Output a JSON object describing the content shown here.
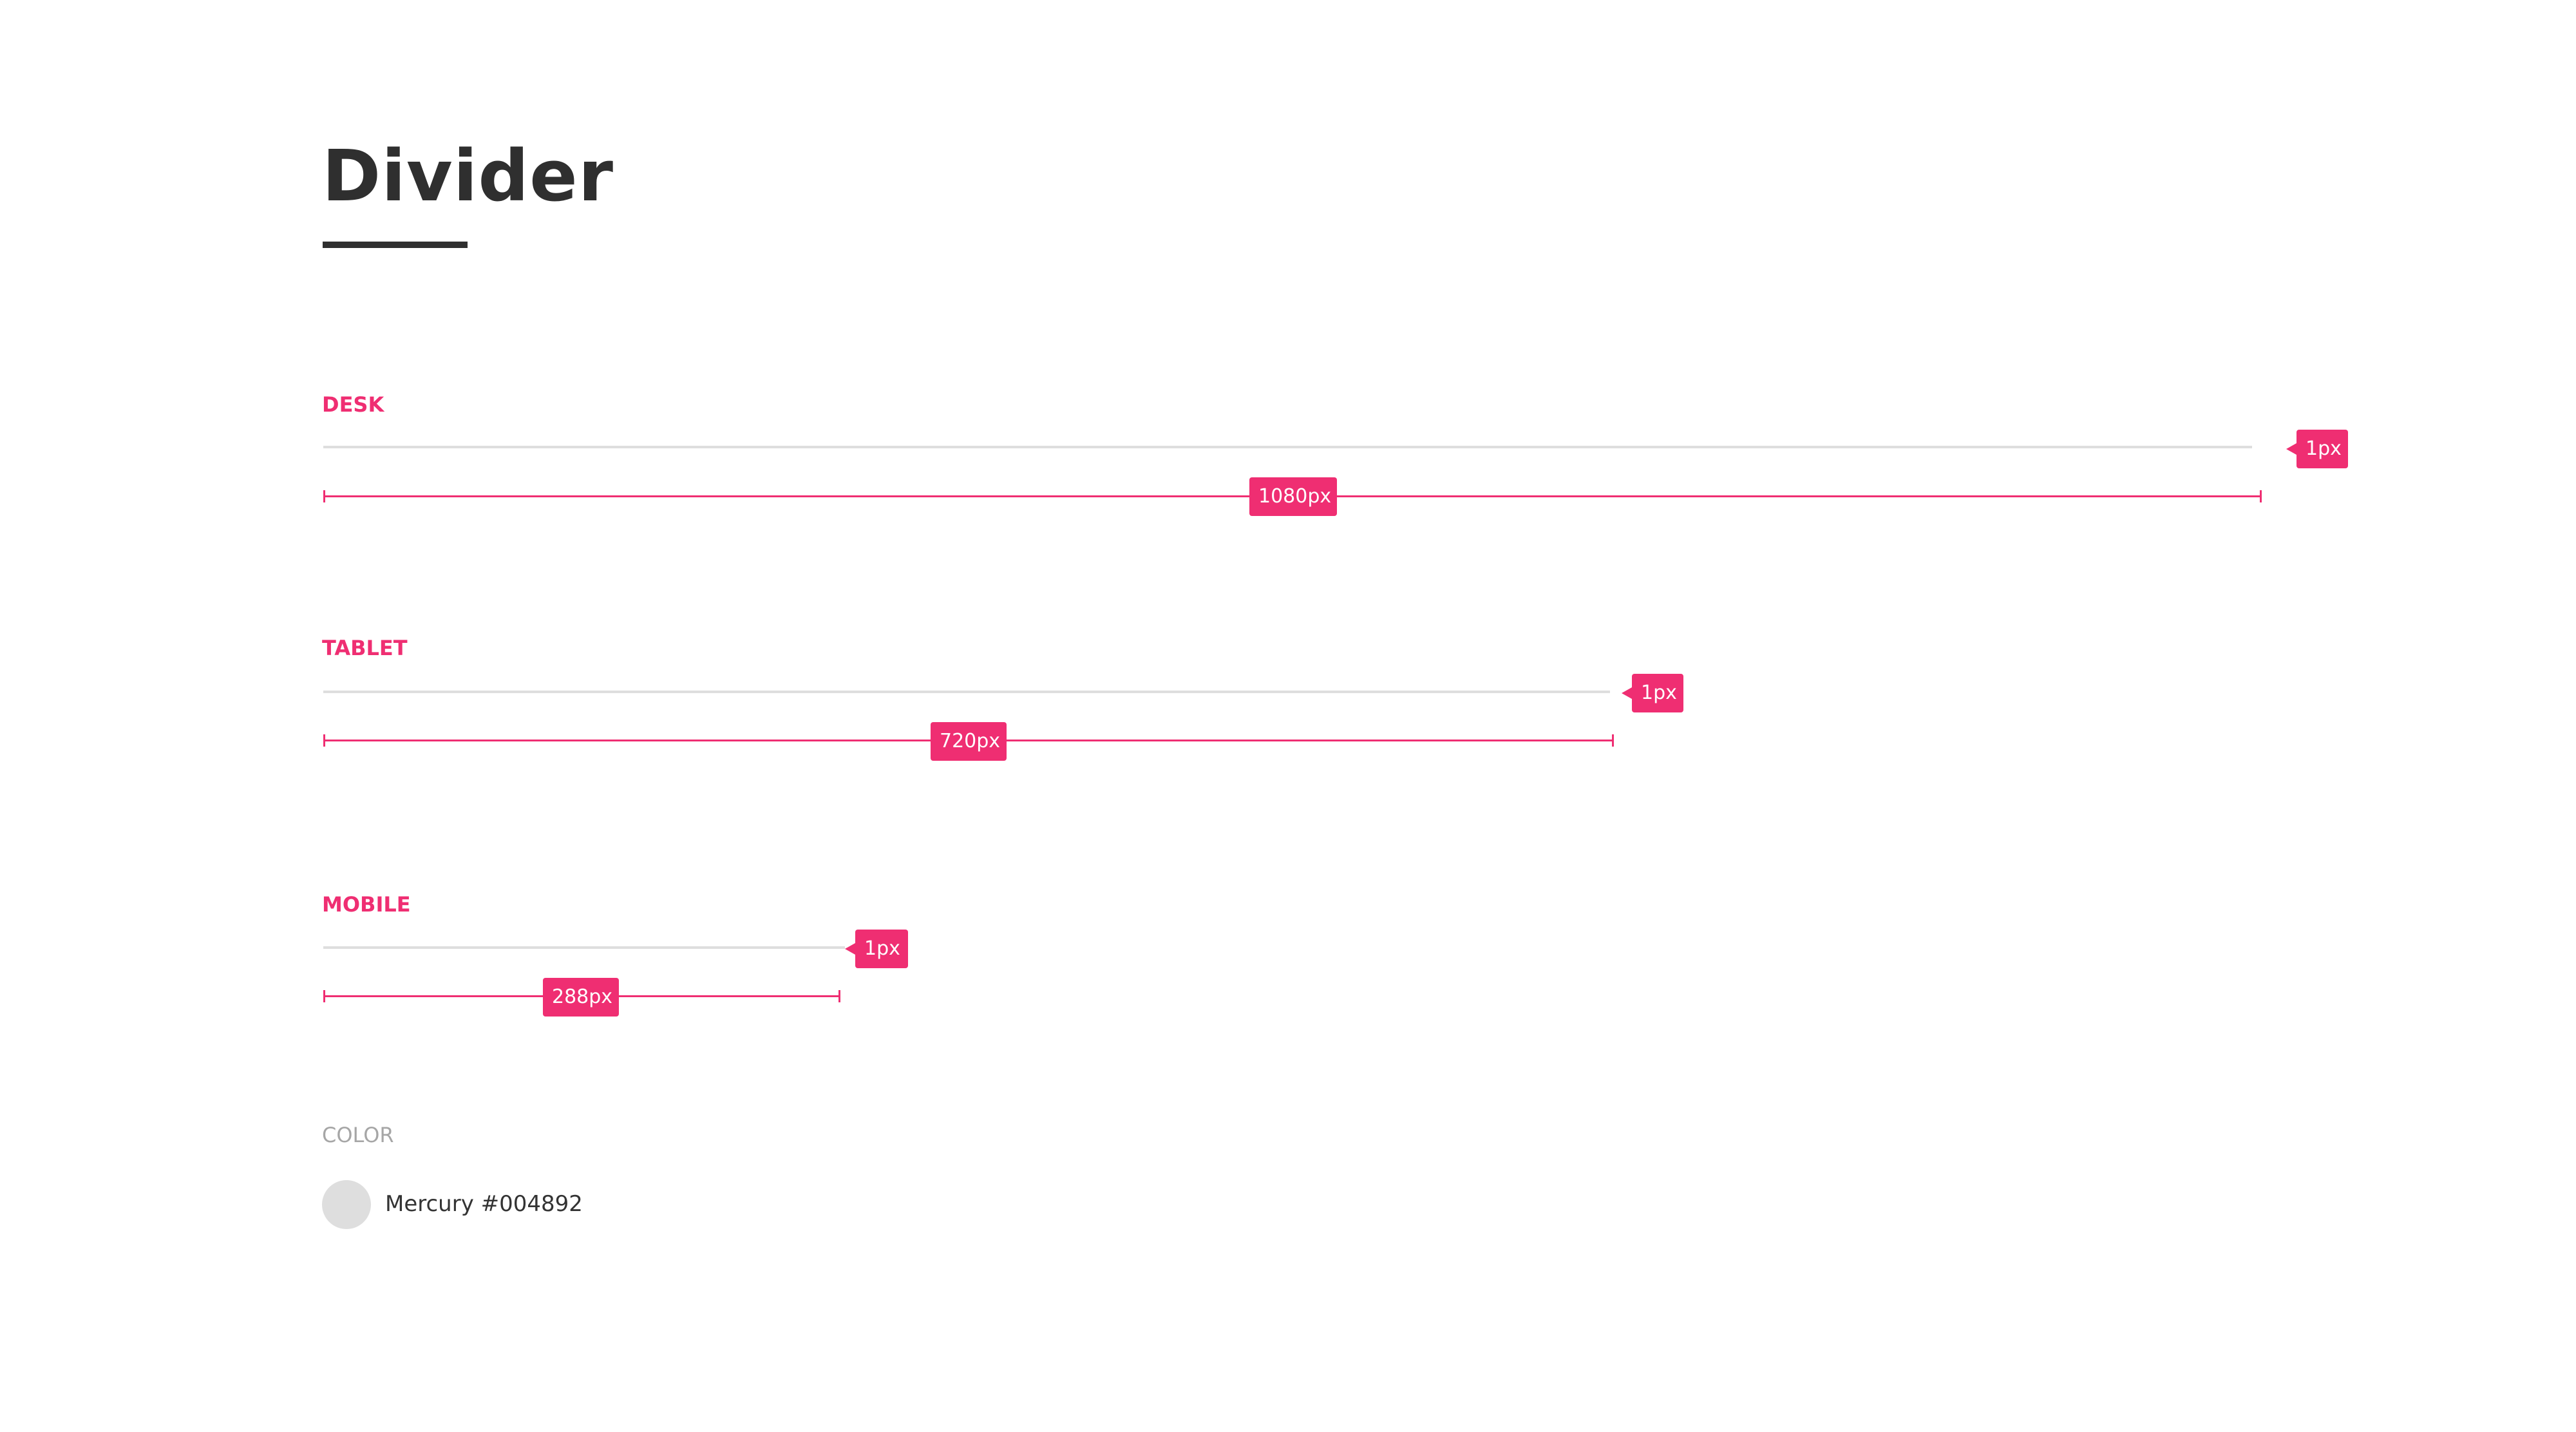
{
  "page": {
    "title": "Divider"
  },
  "sections": [
    {
      "label": "DESK",
      "thickness_label": "1px",
      "width_label": "1080px"
    },
    {
      "label": "TABLET",
      "thickness_label": "1px",
      "width_label": "720px"
    },
    {
      "label": "MOBILE",
      "thickness_label": "1px",
      "width_label": "288px"
    }
  ],
  "color": {
    "label": "COLOR",
    "swatch_text": "Mercury #004892",
    "swatch_hex": "#dedede"
  },
  "accent": "#ef2e72"
}
